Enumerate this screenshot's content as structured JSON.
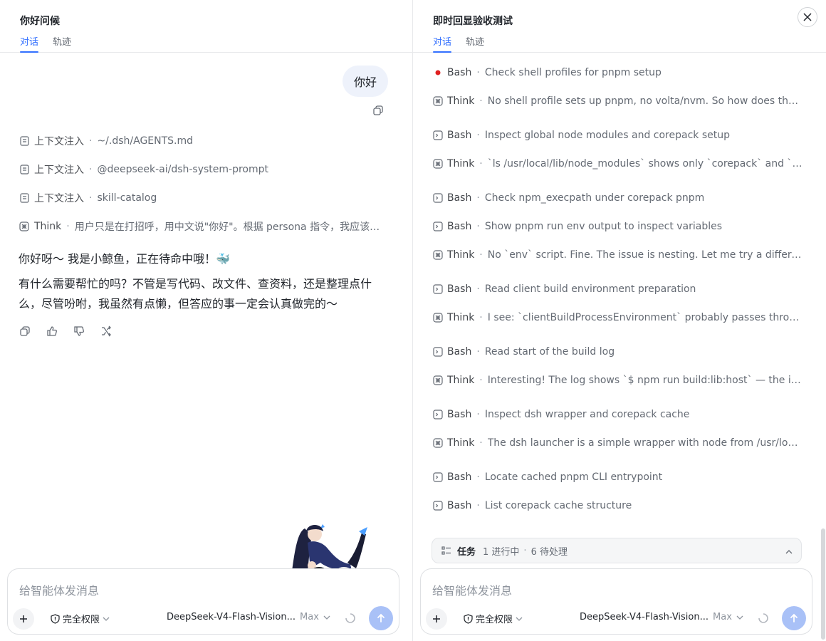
{
  "left": {
    "title": "你好问候",
    "tabs": [
      "对话",
      "轨迹"
    ],
    "user_message": "你好",
    "context_items": [
      {
        "label": "上下文注入",
        "detail": "~/.dsh/AGENTS.md"
      },
      {
        "label": "上下文注入",
        "detail": "@deepseek-ai/dsh-system-prompt"
      },
      {
        "label": "上下文注入",
        "detail": "skill-catalog"
      }
    ],
    "think": {
      "label": "Think",
      "detail": "用户只是在打招呼，用中文说\"你好\"。根据 persona 指令，我应该用…"
    },
    "answer": {
      "line1": "你好呀～ 我是小鲸鱼，正在待命中哦！🐳",
      "line2": "有什么需要帮忙的吗？不管是写代码、改文件、查资料，还是整理点什么，尽管吩咐，我虽然有点懒，但答应的事一定会认真做完的～"
    },
    "badge_count": "0",
    "composer": {
      "placeholder": "给智能体发消息",
      "permission": "完全权限",
      "model": "DeepSeek-V4-Flash-Vision...",
      "level": "Max"
    }
  },
  "right": {
    "title": "即时回显验收测试",
    "tabs": [
      "对话",
      "轨迹"
    ],
    "trace": [
      {
        "type": "Bash",
        "desc": "Check shell profiles for pnpm setup",
        "icon": "running-dot"
      },
      {
        "type": "Think",
        "desc": "No shell profile sets up pnpm, no volta/nvm. So how does the user …",
        "icon": "think-icon"
      },
      {
        "type": "Bash",
        "desc": "Inspect global node modules and corepack setup",
        "icon": "terminal-icon"
      },
      {
        "type": "Think",
        "desc": "`ls /usr/local/lib/node_modules` shows only `corepack` and `npm`…",
        "icon": "think-icon"
      },
      {
        "type": "Bash",
        "desc": "Check npm_execpath under corepack pnpm",
        "icon": "terminal-icon"
      },
      {
        "type": "Bash",
        "desc": "Show pnpm run env output to inspect variables",
        "icon": "terminal-icon"
      },
      {
        "type": "Think",
        "desc": "No `env` script. Fine. The issue is nesting. Let me try a different ap…",
        "icon": "think-icon"
      },
      {
        "type": "Bash",
        "desc": "Read client build environment preparation",
        "icon": "terminal-icon"
      },
      {
        "type": "Think",
        "desc": "I see: `clientBuildProcessEnvironment` probably passes through m…",
        "icon": "think-icon"
      },
      {
        "type": "Bash",
        "desc": "Read start of the build log",
        "icon": "terminal-icon"
      },
      {
        "type": "Think",
        "desc": "Interesting! The log shows `$ npm run build:lib:host` — the inner in…",
        "icon": "think-icon"
      },
      {
        "type": "Bash",
        "desc": "Inspect dsh wrapper and corepack cache",
        "icon": "terminal-icon"
      },
      {
        "type": "Think",
        "desc": "The dsh launcher is a simple wrapper with node from /usr/local/bin.…",
        "icon": "think-icon"
      },
      {
        "type": "Bash",
        "desc": "Locate cached pnpm CLI entrypoint",
        "icon": "terminal-icon"
      },
      {
        "type": "Bash",
        "desc": "List corepack cache structure",
        "icon": "terminal-icon"
      }
    ],
    "tasks": {
      "label": "任务",
      "in_progress": "1 进行中",
      "pending": "6 待处理"
    },
    "composer": {
      "placeholder": "给智能体发消息",
      "permission": "完全权限",
      "model": "DeepSeek-V4-Flash-Vision...",
      "level": "Max"
    }
  },
  "colors": {
    "accent": "#3370ff",
    "running": "#e02020",
    "send": "#a9c1f7"
  }
}
